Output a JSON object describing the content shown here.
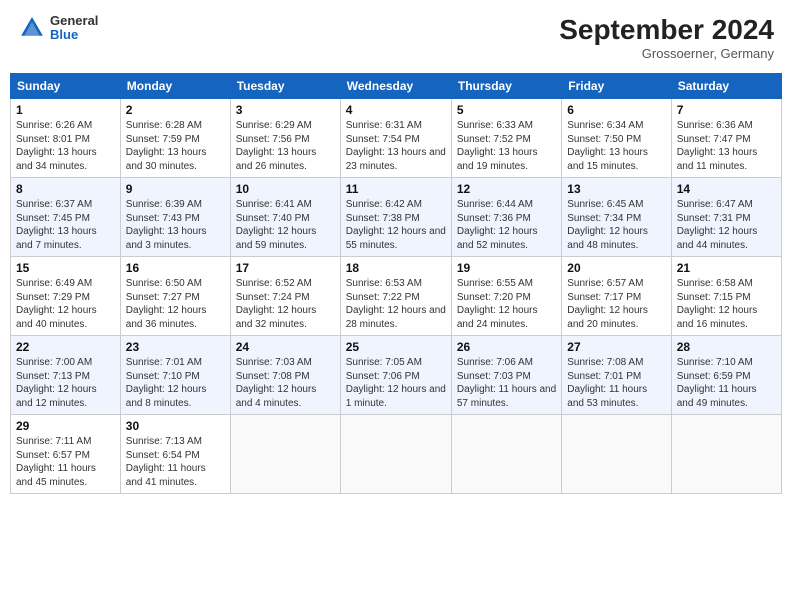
{
  "header": {
    "logo_general": "General",
    "logo_blue": "Blue",
    "month": "September 2024",
    "location": "Grossoerner, Germany"
  },
  "days_of_week": [
    "Sunday",
    "Monday",
    "Tuesday",
    "Wednesday",
    "Thursday",
    "Friday",
    "Saturday"
  ],
  "weeks": [
    [
      {
        "day": 1,
        "sunrise": "6:26 AM",
        "sunset": "8:01 PM",
        "daylight": "13 hours and 34 minutes."
      },
      {
        "day": 2,
        "sunrise": "6:28 AM",
        "sunset": "7:59 PM",
        "daylight": "13 hours and 30 minutes."
      },
      {
        "day": 3,
        "sunrise": "6:29 AM",
        "sunset": "7:56 PM",
        "daylight": "13 hours and 26 minutes."
      },
      {
        "day": 4,
        "sunrise": "6:31 AM",
        "sunset": "7:54 PM",
        "daylight": "13 hours and 23 minutes."
      },
      {
        "day": 5,
        "sunrise": "6:33 AM",
        "sunset": "7:52 PM",
        "daylight": "13 hours and 19 minutes."
      },
      {
        "day": 6,
        "sunrise": "6:34 AM",
        "sunset": "7:50 PM",
        "daylight": "13 hours and 15 minutes."
      },
      {
        "day": 7,
        "sunrise": "6:36 AM",
        "sunset": "7:47 PM",
        "daylight": "13 hours and 11 minutes."
      }
    ],
    [
      {
        "day": 8,
        "sunrise": "6:37 AM",
        "sunset": "7:45 PM",
        "daylight": "13 hours and 7 minutes."
      },
      {
        "day": 9,
        "sunrise": "6:39 AM",
        "sunset": "7:43 PM",
        "daylight": "13 hours and 3 minutes."
      },
      {
        "day": 10,
        "sunrise": "6:41 AM",
        "sunset": "7:40 PM",
        "daylight": "12 hours and 59 minutes."
      },
      {
        "day": 11,
        "sunrise": "6:42 AM",
        "sunset": "7:38 PM",
        "daylight": "12 hours and 55 minutes."
      },
      {
        "day": 12,
        "sunrise": "6:44 AM",
        "sunset": "7:36 PM",
        "daylight": "12 hours and 52 minutes."
      },
      {
        "day": 13,
        "sunrise": "6:45 AM",
        "sunset": "7:34 PM",
        "daylight": "12 hours and 48 minutes."
      },
      {
        "day": 14,
        "sunrise": "6:47 AM",
        "sunset": "7:31 PM",
        "daylight": "12 hours and 44 minutes."
      }
    ],
    [
      {
        "day": 15,
        "sunrise": "6:49 AM",
        "sunset": "7:29 PM",
        "daylight": "12 hours and 40 minutes."
      },
      {
        "day": 16,
        "sunrise": "6:50 AM",
        "sunset": "7:27 PM",
        "daylight": "12 hours and 36 minutes."
      },
      {
        "day": 17,
        "sunrise": "6:52 AM",
        "sunset": "7:24 PM",
        "daylight": "12 hours and 32 minutes."
      },
      {
        "day": 18,
        "sunrise": "6:53 AM",
        "sunset": "7:22 PM",
        "daylight": "12 hours and 28 minutes."
      },
      {
        "day": 19,
        "sunrise": "6:55 AM",
        "sunset": "7:20 PM",
        "daylight": "12 hours and 24 minutes."
      },
      {
        "day": 20,
        "sunrise": "6:57 AM",
        "sunset": "7:17 PM",
        "daylight": "12 hours and 20 minutes."
      },
      {
        "day": 21,
        "sunrise": "6:58 AM",
        "sunset": "7:15 PM",
        "daylight": "12 hours and 16 minutes."
      }
    ],
    [
      {
        "day": 22,
        "sunrise": "7:00 AM",
        "sunset": "7:13 PM",
        "daylight": "12 hours and 12 minutes."
      },
      {
        "day": 23,
        "sunrise": "7:01 AM",
        "sunset": "7:10 PM",
        "daylight": "12 hours and 8 minutes."
      },
      {
        "day": 24,
        "sunrise": "7:03 AM",
        "sunset": "7:08 PM",
        "daylight": "12 hours and 4 minutes."
      },
      {
        "day": 25,
        "sunrise": "7:05 AM",
        "sunset": "7:06 PM",
        "daylight": "12 hours and 1 minute."
      },
      {
        "day": 26,
        "sunrise": "7:06 AM",
        "sunset": "7:03 PM",
        "daylight": "11 hours and 57 minutes."
      },
      {
        "day": 27,
        "sunrise": "7:08 AM",
        "sunset": "7:01 PM",
        "daylight": "11 hours and 53 minutes."
      },
      {
        "day": 28,
        "sunrise": "7:10 AM",
        "sunset": "6:59 PM",
        "daylight": "11 hours and 49 minutes."
      }
    ],
    [
      {
        "day": 29,
        "sunrise": "7:11 AM",
        "sunset": "6:57 PM",
        "daylight": "11 hours and 45 minutes."
      },
      {
        "day": 30,
        "sunrise": "7:13 AM",
        "sunset": "6:54 PM",
        "daylight": "11 hours and 41 minutes."
      },
      null,
      null,
      null,
      null,
      null
    ]
  ]
}
